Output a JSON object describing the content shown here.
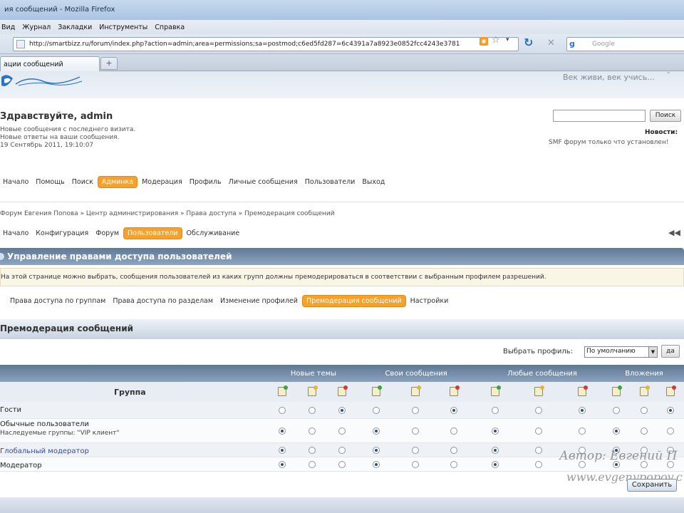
{
  "browser": {
    "title": "ия сообщений - Mozilla Firefox",
    "menu": [
      "Вид",
      "Журнал",
      "Закладки",
      "Инструменты",
      "Справка"
    ],
    "url": "http://smartbizz.ru/forum/index.php?action=admin;area=permissions;sa=postmod;c6ed5fd287=6c4391a7a8923e0852fcc4243e3781",
    "search_placeholder": "Google",
    "tab_label": "ации сообщений",
    "new_tab": "+"
  },
  "forum": {
    "motto": "Век живи, век учись...",
    "greeting": "Здравствуйте, admin",
    "info": [
      "Новые сообщения с последнего визита.",
      "Новые ответы на ваши сообщения.",
      "19 Сентябрь 2011, 19:10:07"
    ],
    "search_button": "Поиск",
    "news_label": "Новости:",
    "news_text": "SMF форум только что установлен!",
    "main_menu": [
      "Начало",
      "Помощь",
      "Поиск",
      "Админка",
      "Модерация",
      "Профиль",
      "Личные сообщения",
      "Пользователи",
      "Выход"
    ],
    "main_menu_active": "Админка",
    "breadcrumb": "Форум Евгения Попова » Центр администрирования » Права доступа » Премодерация сообщений",
    "sub_menu": [
      "Начало",
      "Конфигурация",
      "Форум",
      "Пользователи",
      "Обслуживание"
    ],
    "sub_menu_active": "Пользователи",
    "section_title": "Управление правами доступа пользователей",
    "info_bar": "На этой странице можно выбрать, сообщения пользователей из каких групп должны премодерироваться в соответствии с выбранным профилем разрешений.",
    "tabs": [
      "Права доступа по группам",
      "Права доступа по разделам",
      "Изменение профилей",
      "Премодерация сообщений",
      "Настройки"
    ],
    "tabs_active": "Премодерация сообщений",
    "sub_header": "Премодерация сообщений",
    "profile_label": "Выбрать профиль:",
    "profile_value": "По умолчанию",
    "go_button": "да",
    "group_header": "Группа",
    "column_groups": [
      "Новые темы",
      "Свои сообщения",
      "Любые сообщения",
      "Вложения"
    ],
    "rows": [
      {
        "name": "Гости",
        "sub": "",
        "link": false,
        "selected": [
          2,
          2,
          2,
          2
        ]
      },
      {
        "name": "Обычные пользователи",
        "sub": "Наследуемые группы: \"VIP клиент\"",
        "link": false,
        "selected": [
          0,
          0,
          0,
          0
        ]
      },
      {
        "name": "Глобальный модератор",
        "sub": "",
        "link": true,
        "selected": [
          0,
          0,
          0,
          0
        ]
      },
      {
        "name": "Модератор",
        "sub": "",
        "link": false,
        "selected": [
          0,
          0,
          0,
          0
        ]
      }
    ],
    "save_button": "Сохранить",
    "watermark": [
      "Автор: Евгений П",
      "www.evgenypopov.c"
    ]
  },
  "colors": {
    "accent_orange": "#f7a12d",
    "header_blue": "#5f7894",
    "link_blue": "#2f4bb5",
    "icon_green": "#3da33d",
    "icon_yellow": "#e0b83a",
    "icon_red": "#d23a3a"
  }
}
